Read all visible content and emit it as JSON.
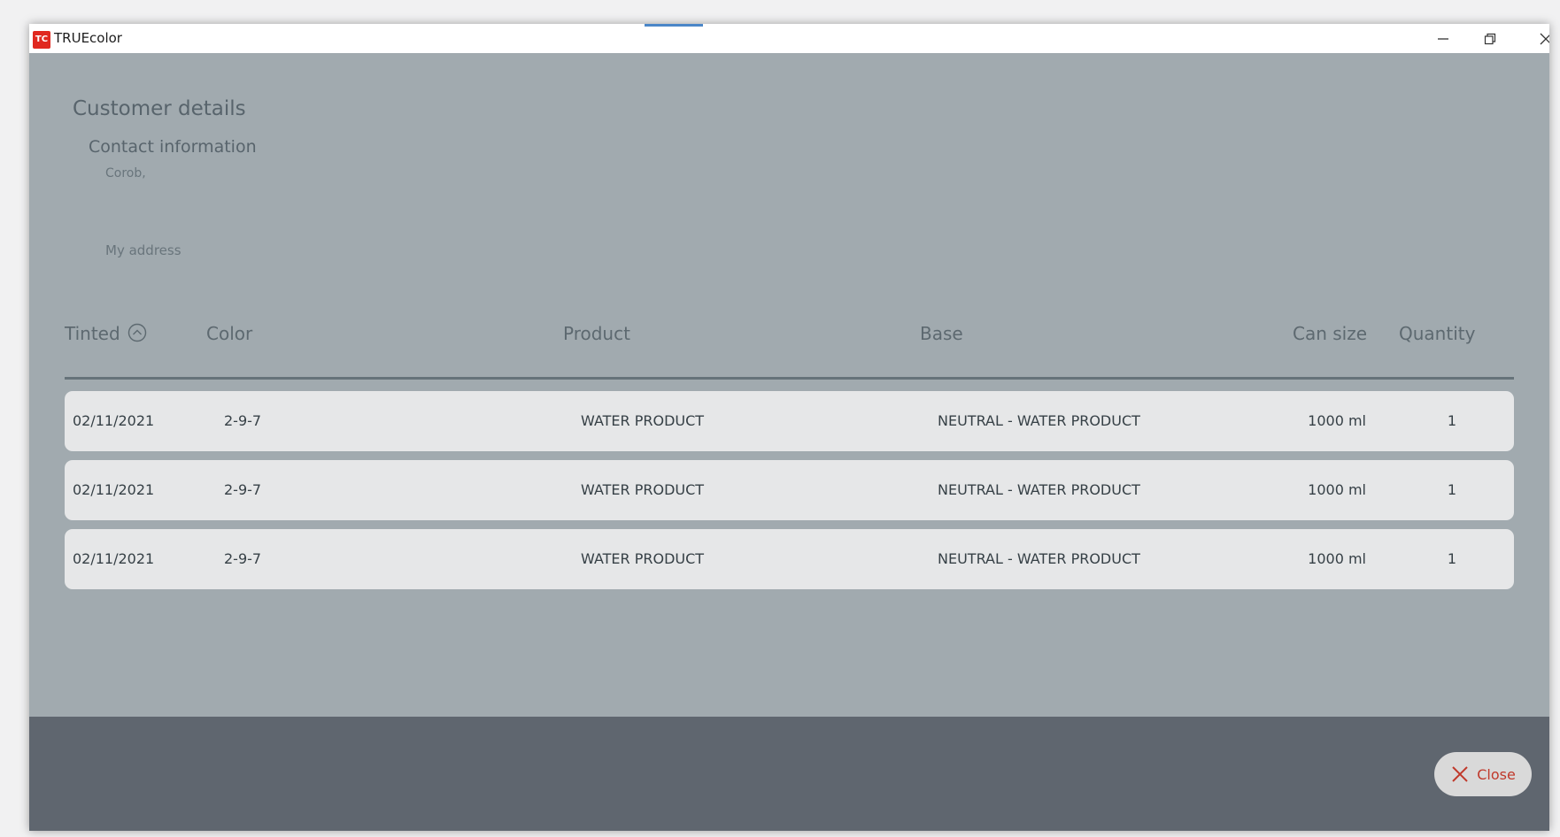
{
  "window": {
    "title": "TRUEcolor",
    "app_icon_label": "TC"
  },
  "customer": {
    "section_title": "Customer details",
    "contact_title": "Contact information",
    "name": "Corob,",
    "address": "My address"
  },
  "table": {
    "columns": [
      "Tinted",
      "Color",
      "Product",
      "Base",
      "Can size",
      "Quantity"
    ],
    "sort_icon": "chevron-up-circle-icon",
    "rows": [
      [
        "02/11/2021",
        "2-9-7",
        "WATER PRODUCT",
        "NEUTRAL - WATER PRODUCT",
        "1000 ml",
        "1"
      ],
      [
        "02/11/2021",
        "2-9-7",
        "WATER PRODUCT",
        "NEUTRAL - WATER PRODUCT",
        "1000 ml",
        "1"
      ],
      [
        "02/11/2021",
        "2-9-7",
        "WATER PRODUCT",
        "NEUTRAL - WATER PRODUCT",
        "1000 ml",
        "1"
      ]
    ]
  },
  "footer": {
    "close_label": "Close",
    "close_icon": "close-icon"
  },
  "colors": {
    "background": "#a1aaaf",
    "footer": "#5f666f",
    "row": "#e6e7e8",
    "accent_red": "#c0392b"
  }
}
